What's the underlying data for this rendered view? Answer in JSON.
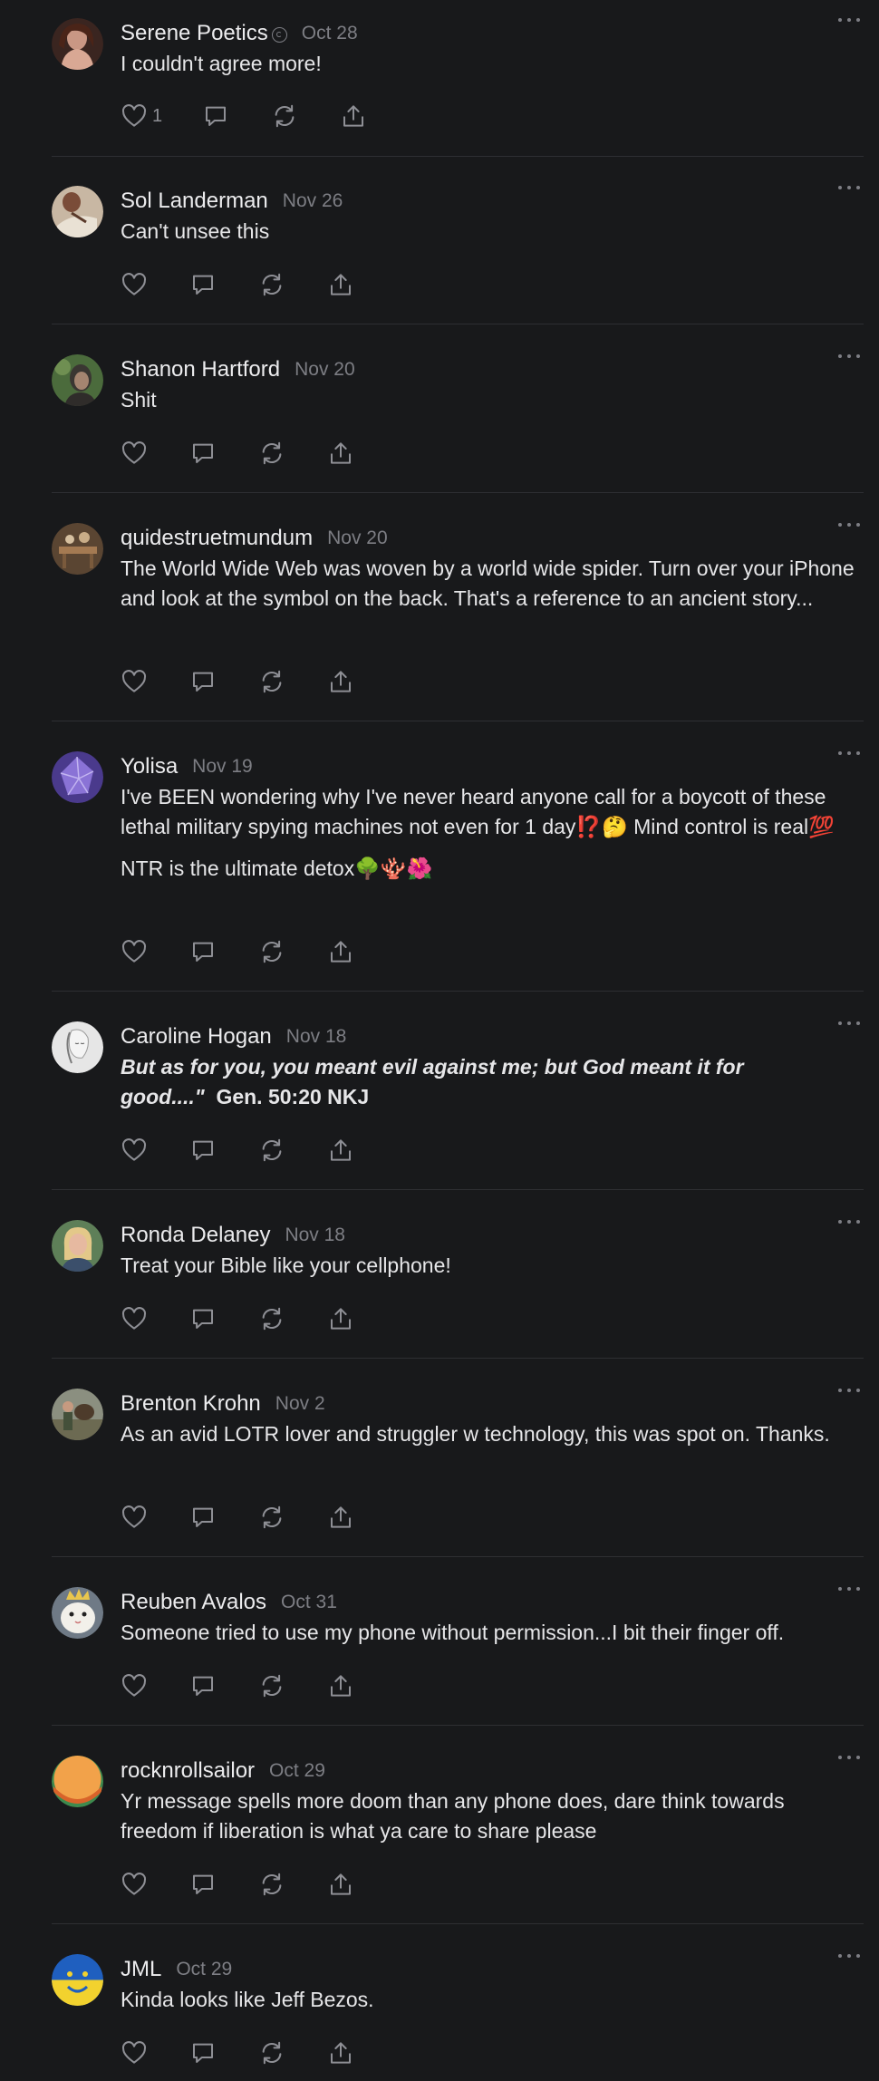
{
  "colors": {
    "background": "#18191b",
    "divider": "#2e2f33",
    "muted": "#7d7e84",
    "icon": "#8e8f95"
  },
  "comments": [
    {
      "name": "Serene Poetics",
      "verified_badge": true,
      "date": "Oct 28",
      "paragraphs": [
        "I couldn't agree more!"
      ],
      "like_count": "1",
      "avatar": "portrait-woman-dark-hair"
    },
    {
      "name": "Sol Landerman",
      "date": "Nov 26",
      "paragraphs": [
        "Can't unsee this"
      ],
      "avatar": "portrait-man-writing"
    },
    {
      "name": "Shanon Hartford",
      "date": "Nov 20",
      "paragraphs": [
        "Shit"
      ],
      "avatar": "portrait-outdoors-green"
    },
    {
      "name": "quidestruetmundum",
      "date": "Nov 20",
      "paragraphs": [
        "The World Wide Web was woven by a world wide spider. Turn over your iPhone and look at the symbol on the back. That's a reference to an ancient story..."
      ],
      "avatar": "interior-scene-brown"
    },
    {
      "name": "Yolisa",
      "date": "Nov 19",
      "paragraphs": [
        "I've BEEN wondering why I've never heard anyone call for a boycott of these lethal military spying machines not even for 1 day⁉️🤔 Mind control is real💯",
        "NTR is the ultimate detox🌳🪸🌺"
      ],
      "avatar": "purple-crystal"
    },
    {
      "name": "Caroline Hogan",
      "date": "Nov 18",
      "quote_text": "But as for you, you meant evil against me; but God meant it for good....\"",
      "reference_text": "Gen.  50:20  NKJ",
      "avatar": "portrait-sketch-grayscale"
    },
    {
      "name": "Ronda Delaney",
      "date": "Nov 18",
      "paragraphs": [
        "Treat your Bible like your cellphone!"
      ],
      "avatar": "portrait-blonde-woman"
    },
    {
      "name": "Brenton Krohn",
      "date": "Nov 2",
      "paragraphs": [
        "As an avid LOTR lover and struggler w technology, this was spot on. Thanks."
      ],
      "avatar": "portrait-man-with-horse"
    },
    {
      "name": "Reuben Avalos",
      "date": "Oct 31",
      "paragraphs": [
        "Someone tried to use my phone without permission...I bit their finger off."
      ],
      "avatar": "cat-with-crown"
    },
    {
      "name": "rocknrollsailor",
      "date": "Oct 29",
      "paragraphs": [
        "Yr message spells more doom than any phone does, dare think towards freedom if liberation is what ya care to share please"
      ],
      "avatar": "orange-green-circle"
    },
    {
      "name": "JML",
      "date": "Oct 29",
      "paragraphs": [
        "Kinda looks like Jeff Bezos."
      ],
      "avatar": "blue-yellow-smiley"
    }
  ]
}
